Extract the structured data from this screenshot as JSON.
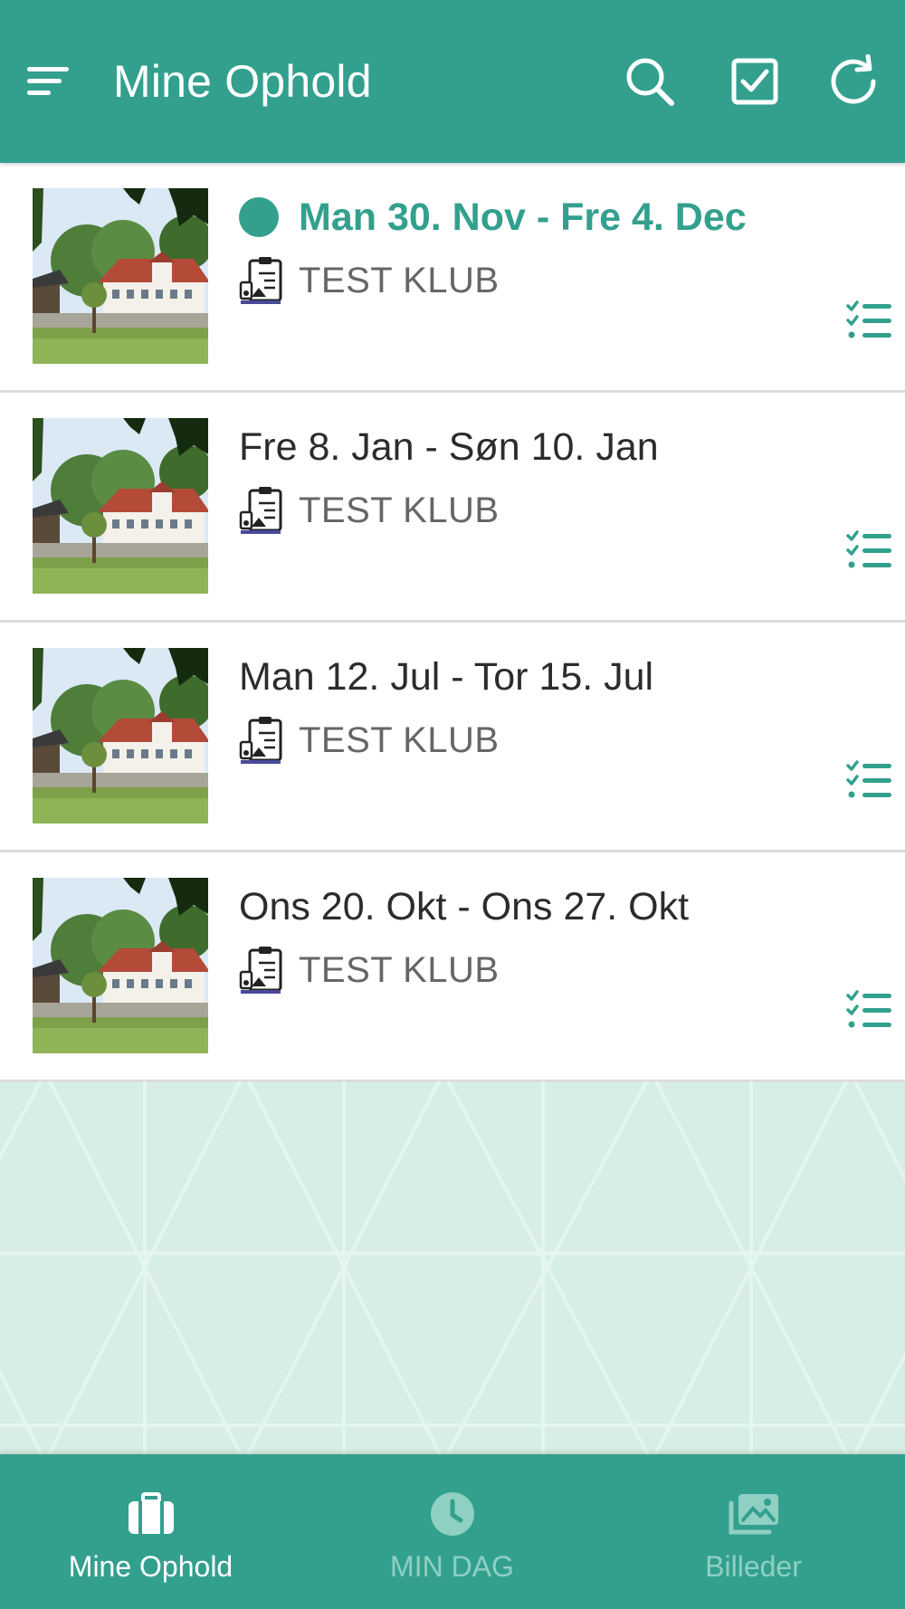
{
  "header": {
    "title": "Mine Ophold",
    "icons": [
      "menu-icon",
      "search-icon",
      "checkbox-icon",
      "refresh-icon"
    ]
  },
  "stays": [
    {
      "date": "Man 30. Nov - Fre 4. Dec",
      "club": "TEST KLUB",
      "active": true
    },
    {
      "date": "Fre 8. Jan - Søn 10. Jan",
      "club": "TEST KLUB",
      "active": false
    },
    {
      "date": "Man 12. Jul - Tor 15. Jul",
      "club": "TEST KLUB",
      "active": false
    },
    {
      "date": "Ons 20. Okt - Ons 27. Okt",
      "club": "TEST KLUB",
      "active": false
    }
  ],
  "nav": [
    {
      "label": "Mine Ophold",
      "icon": "suitcase-icon",
      "active": true
    },
    {
      "label": "MIN DAG",
      "icon": "clock-icon",
      "active": false
    },
    {
      "label": "Billeder",
      "icon": "images-icon",
      "active": false
    }
  ],
  "colors": {
    "primary": "#33a08e",
    "background": "#d7eee4",
    "inactive_nav": "#8fd0c3"
  }
}
